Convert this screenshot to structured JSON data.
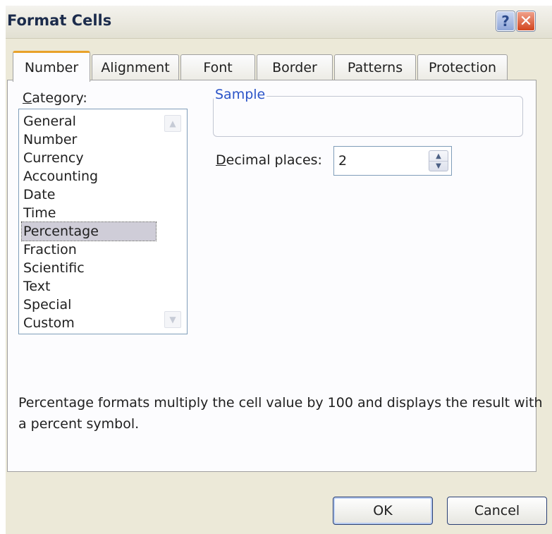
{
  "window": {
    "title": "Format Cells",
    "help_label": "?",
    "close_label": "✕"
  },
  "tabs": [
    {
      "label": "Number",
      "active": true
    },
    {
      "label": "Alignment",
      "active": false
    },
    {
      "label": "Font",
      "active": false
    },
    {
      "label": "Border",
      "active": false
    },
    {
      "label": "Patterns",
      "active": false
    },
    {
      "label": "Protection",
      "active": false
    }
  ],
  "category": {
    "label_first": "C",
    "label_rest": "ategory:",
    "items": [
      "General",
      "Number",
      "Currency",
      "Accounting",
      "Date",
      "Time",
      "Percentage",
      "Fraction",
      "Scientific",
      "Text",
      "Special",
      "Custom"
    ],
    "selected": "Percentage"
  },
  "sample": {
    "label": "Sample"
  },
  "decimal_places": {
    "label_first": "D",
    "label_rest": "ecimal places:",
    "value": "2"
  },
  "description": "Percentage formats multiply the cell value by 100 and displays the result with a percent symbol.",
  "buttons": {
    "ok": "OK",
    "cancel": "Cancel"
  }
}
